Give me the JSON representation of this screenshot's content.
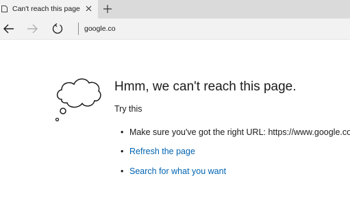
{
  "browser": {
    "tab": {
      "title": "Can't reach this page",
      "favicon": "page-icon",
      "close_icon": "close-icon"
    },
    "new_tab_icon": "plus-icon",
    "nav": {
      "back_icon": "back-arrow-icon",
      "forward_icon": "forward-arrow-icon",
      "refresh_icon": "refresh-icon"
    },
    "address": "google.co"
  },
  "error_page": {
    "icon": "thought-cloud-icon",
    "headline": "Hmm, we can't reach this page.",
    "try_this": "Try this",
    "suggestions": [
      {
        "bullet": "•",
        "text": "Make sure you've got the right URL: https://www.google.co",
        "link": false
      },
      {
        "bullet": "•",
        "text": "Refresh the page",
        "link": true
      },
      {
        "bullet": "•",
        "text": "Search for what you want",
        "link": true
      }
    ],
    "link_color": "#0063b1"
  }
}
